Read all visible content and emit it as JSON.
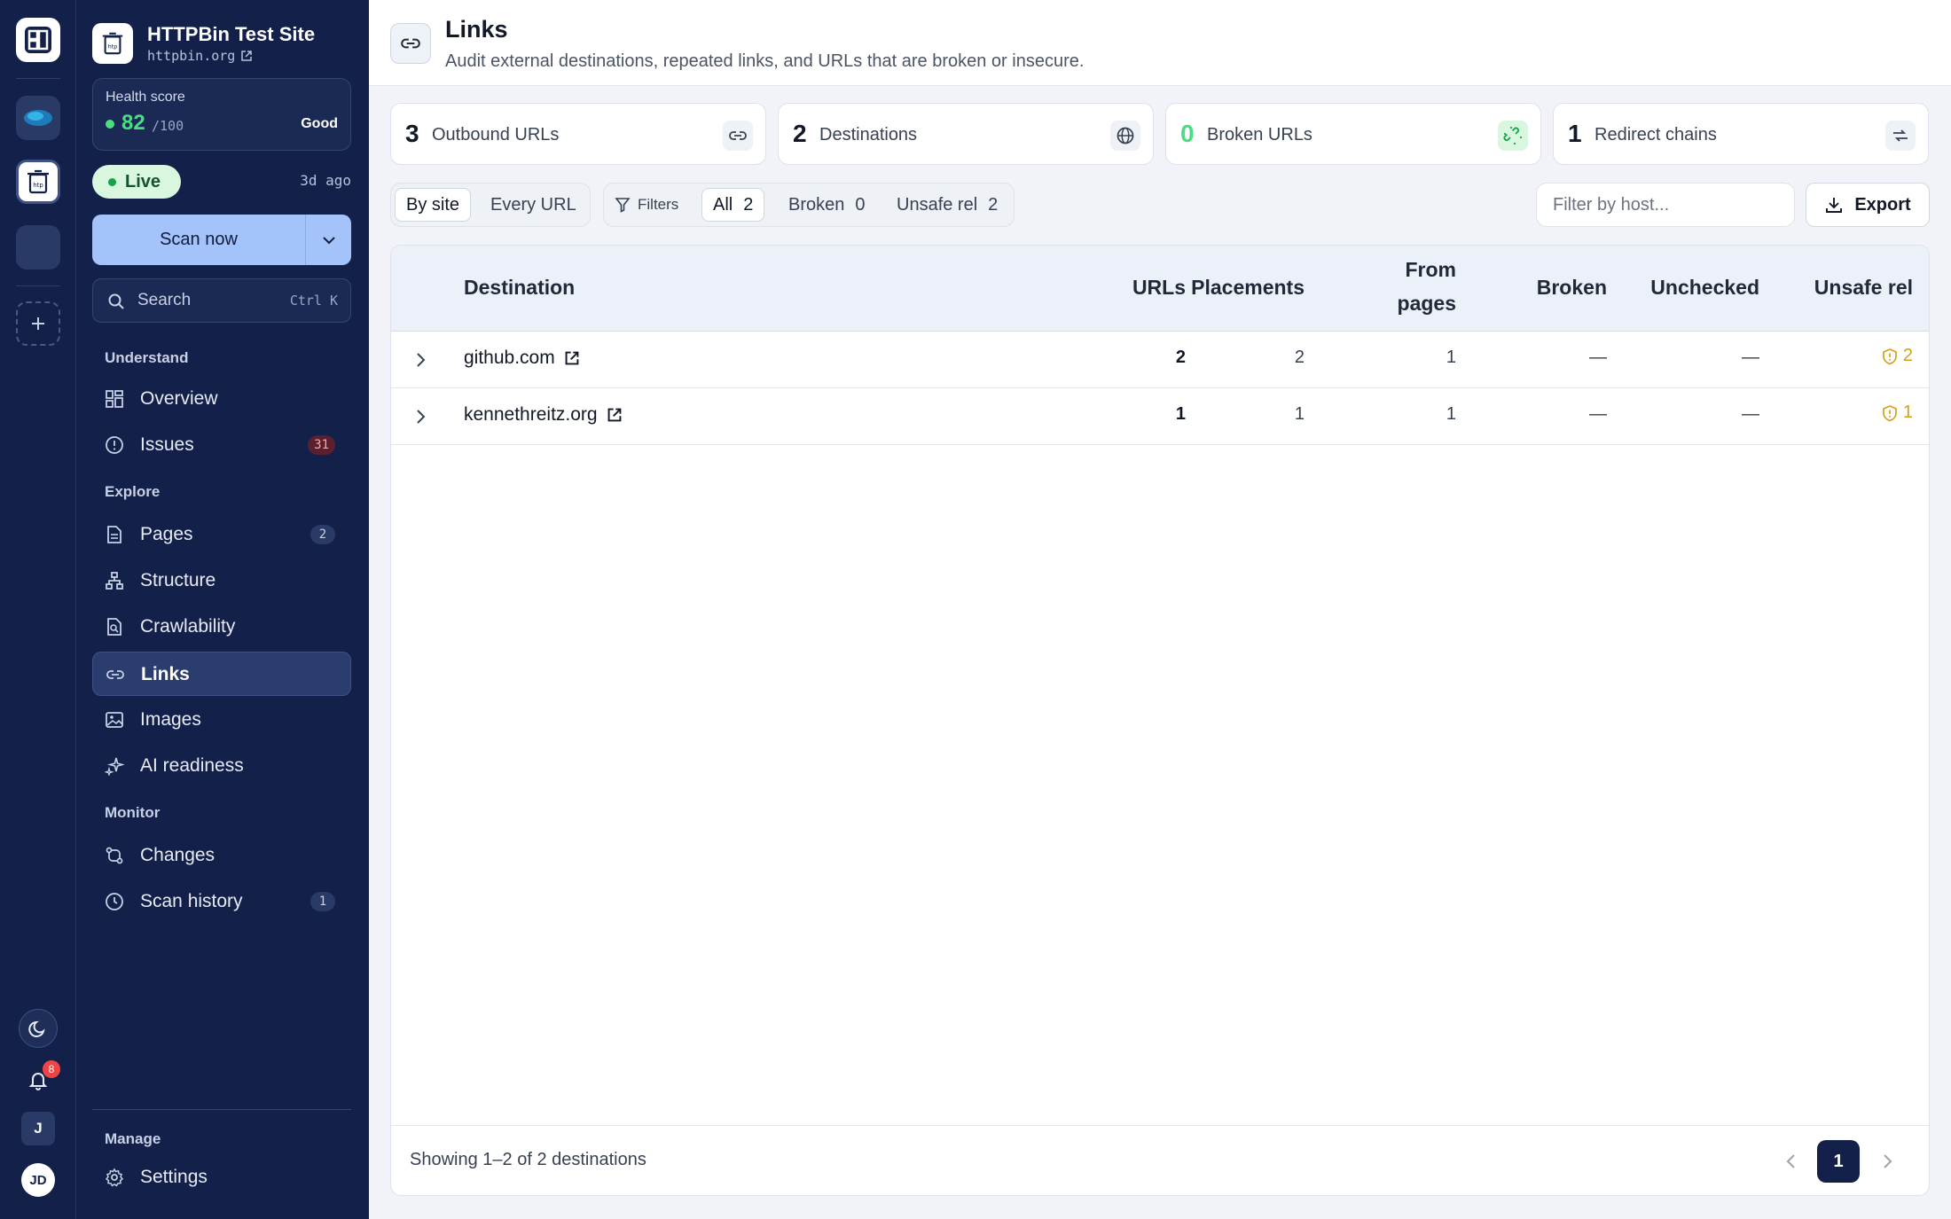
{
  "site": {
    "name": "HTTPBin Test Site",
    "url": "httpbin.org"
  },
  "health": {
    "label": "Health score",
    "score": "82",
    "max": "/100",
    "rating": "Good"
  },
  "status": {
    "live": "Live",
    "last_scan": "3d ago"
  },
  "scan_button": {
    "label": "Scan now"
  },
  "search": {
    "placeholder": "Search",
    "shortcut": "Ctrl K"
  },
  "nav": {
    "understand": "Understand",
    "explore": "Explore",
    "monitor": "Monitor",
    "manage": "Manage",
    "items": {
      "overview": {
        "label": "Overview"
      },
      "issues": {
        "label": "Issues",
        "badge": "31"
      },
      "pages": {
        "label": "Pages",
        "badge": "2"
      },
      "structure": {
        "label": "Structure"
      },
      "crawlability": {
        "label": "Crawlability"
      },
      "links": {
        "label": "Links"
      },
      "images": {
        "label": "Images"
      },
      "ai_readiness": {
        "label": "AI readiness"
      },
      "changes": {
        "label": "Changes"
      },
      "scan_history": {
        "label": "Scan history",
        "badge": "1"
      },
      "settings": {
        "label": "Settings"
      }
    }
  },
  "rail": {
    "notification_count": "8",
    "user_initial": "J",
    "avatar_initials": "JD"
  },
  "page": {
    "title": "Links",
    "subtitle": "Audit external destinations, repeated links, and URLs that are broken or insecure."
  },
  "stats": [
    {
      "value": "3",
      "label": "Outbound URLs",
      "icon": "link-icon"
    },
    {
      "value": "2",
      "label": "Destinations",
      "icon": "globe-icon"
    },
    {
      "value": "0",
      "label": "Broken URLs",
      "icon": "broken-link-icon",
      "value_color": "#4ade80"
    },
    {
      "value": "1",
      "label": "Redirect chains",
      "icon": "redirect-icon"
    }
  ],
  "view_toggle": {
    "by_site": "By site",
    "every_url": "Every URL"
  },
  "filters": {
    "label": "Filters",
    "all": {
      "label": "All",
      "count": "2"
    },
    "broken": {
      "label": "Broken",
      "count": "0"
    },
    "unsafe_rel": {
      "label": "Unsafe rel",
      "count": "2"
    }
  },
  "host_filter": {
    "placeholder": "Filter by host..."
  },
  "export": {
    "label": "Export"
  },
  "table": {
    "columns": {
      "destination": "Destination",
      "urls": "URLs",
      "placements": "Placements",
      "from_pages_1": "From",
      "from_pages_2": "pages",
      "broken": "Broken",
      "unchecked": "Unchecked",
      "unsafe_rel": "Unsafe rel"
    },
    "rows": [
      {
        "host": "github.com",
        "urls": "2",
        "placements": "2",
        "from_pages": "1",
        "broken": "—",
        "unchecked": "—",
        "unsafe_rel": "2"
      },
      {
        "host": "kennethreitz.org",
        "urls": "1",
        "placements": "1",
        "from_pages": "1",
        "broken": "—",
        "unchecked": "—",
        "unsafe_rel": "1"
      }
    ],
    "footer": "Showing 1–2 of 2 destinations",
    "current_page": "1"
  },
  "colors": {
    "sidebar_bg": "#13204a",
    "accent": "#a5c3fb",
    "good": "#4ade80",
    "warning": "#d4a017",
    "danger": "#ef4444"
  }
}
